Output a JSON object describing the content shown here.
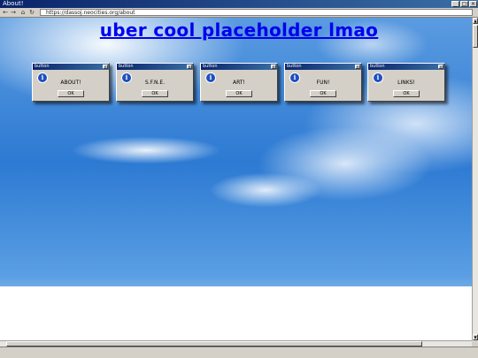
{
  "window": {
    "title": "About!"
  },
  "nav": {
    "back_icon": "back-arrow-icon",
    "forward_icon": "forward-arrow-icon",
    "home_icon": "home-icon",
    "reload_icon": "reload-icon",
    "url": "https://dassoj.neocities.org/about"
  },
  "page": {
    "title": "uber cool placeholder lmao",
    "dialogs": [
      {
        "title": "button",
        "message": "ABOUT!",
        "ok_label": "OK",
        "icon": "info-icon"
      },
      {
        "title": "button",
        "message": "S.F.N.E.",
        "ok_label": "OK",
        "icon": "info-icon"
      },
      {
        "title": "button",
        "message": "ART!",
        "ok_label": "OK",
        "icon": "info-icon"
      },
      {
        "title": "button",
        "message": "FUN!",
        "ok_label": "OK",
        "icon": "info-icon"
      },
      {
        "title": "button",
        "message": "LINKS!",
        "ok_label": "OK",
        "icon": "info-icon"
      }
    ]
  }
}
